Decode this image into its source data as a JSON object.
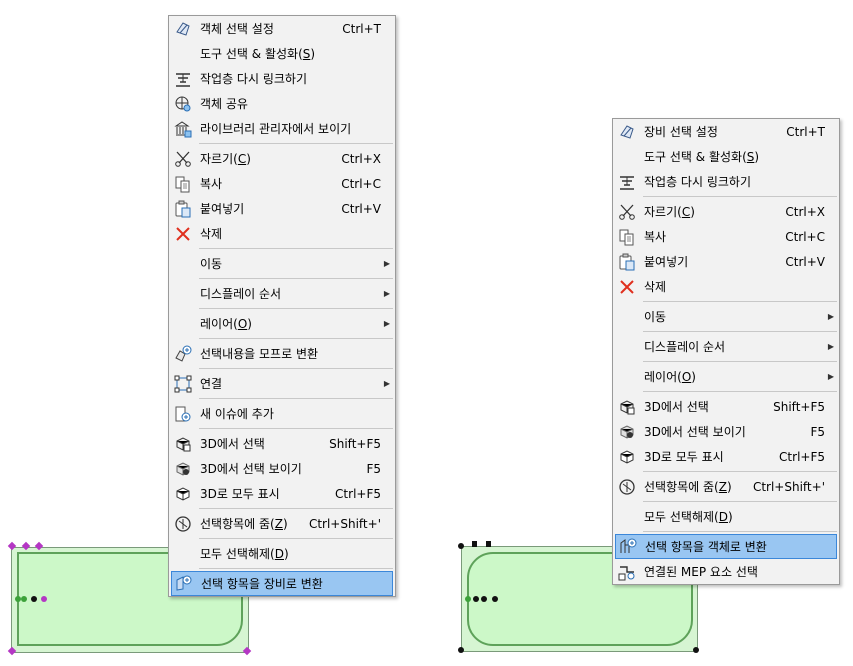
{
  "left_menu": {
    "groups": [
      [
        {
          "icon": "object-select-settings-icon",
          "label": "객체 선택 설정",
          "shortcut": "Ctrl+T"
        },
        {
          "icon": "",
          "label": "도구 선택 & 활성화(S)",
          "shortcut": ""
        },
        {
          "icon": "relink-story-icon",
          "label": "작업층 다시 링크하기",
          "shortcut": ""
        },
        {
          "icon": "object-share-icon",
          "label": "객체 공유",
          "shortcut": ""
        },
        {
          "icon": "library-manager-icon",
          "label": "라이브러리 관리자에서 보이기",
          "shortcut": ""
        }
      ],
      [
        {
          "icon": "scissors-icon",
          "label": "자르기(C)",
          "shortcut": "Ctrl+X"
        },
        {
          "icon": "copy-icon",
          "label": "복사",
          "shortcut": "Ctrl+C"
        },
        {
          "icon": "paste-icon",
          "label": "붙여넣기",
          "shortcut": "Ctrl+V"
        },
        {
          "icon": "delete-x-icon",
          "label": "삭제",
          "shortcut": ""
        }
      ],
      [
        {
          "icon": "",
          "label": "이동",
          "shortcut": "",
          "submenu": true
        }
      ],
      [
        {
          "icon": "",
          "label": "디스플레이 순서",
          "shortcut": "",
          "submenu": true
        }
      ],
      [
        {
          "icon": "",
          "label": "레이어(O)",
          "shortcut": "",
          "submenu": true
        }
      ],
      [
        {
          "icon": "convert-to-morph-icon",
          "label": "선택내용을 모프로 변환",
          "shortcut": ""
        }
      ],
      [
        {
          "icon": "connect-icon",
          "label": "연결",
          "shortcut": "",
          "submenu": true
        }
      ],
      [
        {
          "icon": "new-issue-icon",
          "label": "새 이슈에 추가",
          "shortcut": ""
        }
      ],
      [
        {
          "icon": "select-in-3d-icon",
          "label": "3D에서 선택",
          "shortcut": "Shift+F5"
        },
        {
          "icon": "show-selection-3d-icon",
          "label": "3D에서 선택 보이기",
          "shortcut": "F5"
        },
        {
          "icon": "show-all-3d-icon",
          "label": "3D로 모두 표시",
          "shortcut": "Ctrl+F5"
        }
      ],
      [
        {
          "icon": "zoom-to-selection-icon",
          "label": "선택항목에 줌(Z)",
          "shortcut": "Ctrl+Shift+'"
        }
      ],
      [
        {
          "icon": "",
          "label": "모두 선택해제(D)",
          "shortcut": ""
        }
      ],
      [
        {
          "icon": "convert-to-equipment-icon",
          "label": "선택 항목을 장비로 변환",
          "shortcut": "",
          "highlighted": true
        }
      ]
    ]
  },
  "right_menu": {
    "groups": [
      [
        {
          "icon": "equipment-select-settings-icon",
          "label": "장비 선택 설정",
          "shortcut": "Ctrl+T"
        },
        {
          "icon": "",
          "label": "도구 선택 & 활성화(S)",
          "shortcut": ""
        },
        {
          "icon": "relink-story-icon",
          "label": "작업층 다시 링크하기",
          "shortcut": ""
        }
      ],
      [
        {
          "icon": "scissors-icon",
          "label": "자르기(C)",
          "shortcut": "Ctrl+X"
        },
        {
          "icon": "copy-icon",
          "label": "복사",
          "shortcut": "Ctrl+C"
        },
        {
          "icon": "paste-icon",
          "label": "붙여넣기",
          "shortcut": "Ctrl+V"
        },
        {
          "icon": "delete-x-icon",
          "label": "삭제",
          "shortcut": ""
        }
      ],
      [
        {
          "icon": "",
          "label": "이동",
          "shortcut": "",
          "submenu": true
        }
      ],
      [
        {
          "icon": "",
          "label": "디스플레이 순서",
          "shortcut": "",
          "submenu": true
        }
      ],
      [
        {
          "icon": "",
          "label": "레이어(O)",
          "shortcut": "",
          "submenu": true
        }
      ],
      [
        {
          "icon": "select-in-3d-icon",
          "label": "3D에서 선택",
          "shortcut": "Shift+F5"
        },
        {
          "icon": "show-selection-3d-icon",
          "label": "3D에서 선택 보이기",
          "shortcut": "F5"
        },
        {
          "icon": "show-all-3d-icon",
          "label": "3D로 모두 표시",
          "shortcut": "Ctrl+F5"
        }
      ],
      [
        {
          "icon": "zoom-to-selection-icon",
          "label": "선택항목에 줌(Z)",
          "shortcut": "Ctrl+Shift+'"
        }
      ],
      [
        {
          "icon": "",
          "label": "모두 선택해제(D)",
          "shortcut": ""
        }
      ],
      [
        {
          "icon": "convert-to-object-icon",
          "label": "선택 항목을 객체로 변환",
          "shortcut": "",
          "highlighted": true
        },
        {
          "icon": "connected-mep-select-icon",
          "label": "연결된 MEP 요소 선택",
          "shortcut": ""
        }
      ]
    ]
  },
  "colors": {
    "menu_bg": "#f2f2f2",
    "highlight_bg": "#99c6f2",
    "highlight_border": "#3b87d9",
    "shape_fill": "#ccf8c8",
    "shape_stroke": "#5ea25a",
    "hotspot_magenta": "#b437c4",
    "delete_red": "#e0301e"
  }
}
